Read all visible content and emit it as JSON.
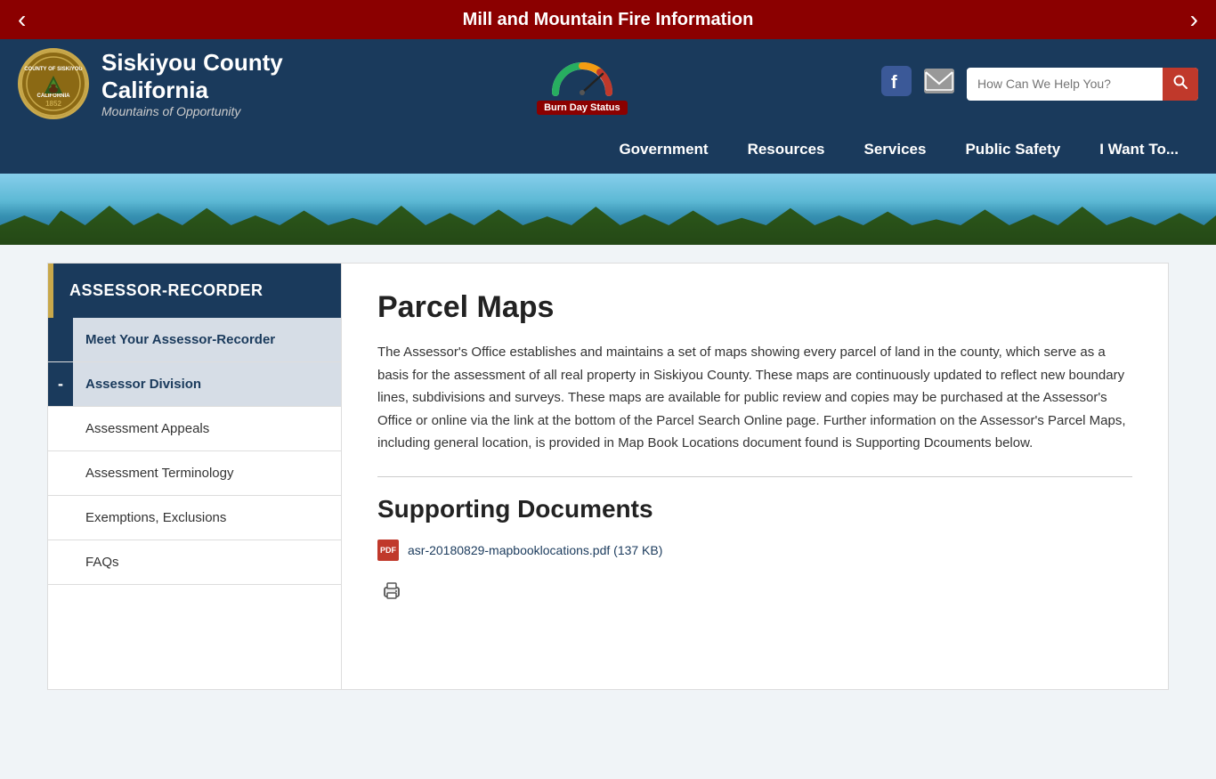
{
  "alert": {
    "text": "Mill and Mountain Fire Information",
    "prev_label": "‹",
    "next_label": "›"
  },
  "header": {
    "logo_text": "COUNTY OF SISKIYOU\n1852\nCALIFORNIA",
    "site_name_line1": "Siskiyou County",
    "site_name_line2": "California",
    "tagline": "Mountains of Opportunity",
    "burn_day_label": "Burn Day Status",
    "facebook_icon": "f",
    "email_icon": "✉",
    "search_placeholder": "How Can We Help You?",
    "search_icon": "🔍"
  },
  "nav": {
    "items": [
      {
        "label": "Government",
        "id": "government"
      },
      {
        "label": "Resources",
        "id": "resources"
      },
      {
        "label": "Services",
        "id": "services"
      },
      {
        "label": "Public Safety",
        "id": "public-safety"
      },
      {
        "label": "I Want To...",
        "id": "i-want-to"
      }
    ]
  },
  "sidebar": {
    "header_label": "ASSESSOR-RECORDER",
    "items": [
      {
        "label": "Meet Your Assessor-Recorder",
        "has_indicator": true,
        "indicator": "",
        "id": "meet-assessor"
      },
      {
        "label": "Assessor Division",
        "has_indicator": true,
        "indicator": "-",
        "id": "assessor-division",
        "sub_items": [
          {
            "label": "Assessment Appeals",
            "id": "assessment-appeals"
          },
          {
            "label": "Assessment Terminology",
            "id": "assessment-terminology"
          },
          {
            "label": "Exemptions, Exclusions",
            "id": "exemptions-exclusions"
          },
          {
            "label": "FAQs",
            "id": "faqs"
          }
        ]
      }
    ]
  },
  "main": {
    "page_title": "Parcel Maps",
    "description": "The Assessor's Office establishes and maintains a set of maps showing every parcel of land in the county, which serve as a basis for the assessment of all real property in Siskiyou County. These maps are continuously updated to reflect new boundary lines, subdivisions and surveys. These maps are available for public review and copies may be purchased at the Assessor's Office or online via the link at the bottom of the Parcel Search Online page. Further information on the Assessor's Parcel Maps, including general location, is provided in Map Book Locations document found is Supporting Dcouments below.",
    "supporting_docs_title": "Supporting Documents",
    "doc_filename": "asr-20180829-mapbooklocations.pdf (137 KB)",
    "print_icon": "🖨"
  }
}
